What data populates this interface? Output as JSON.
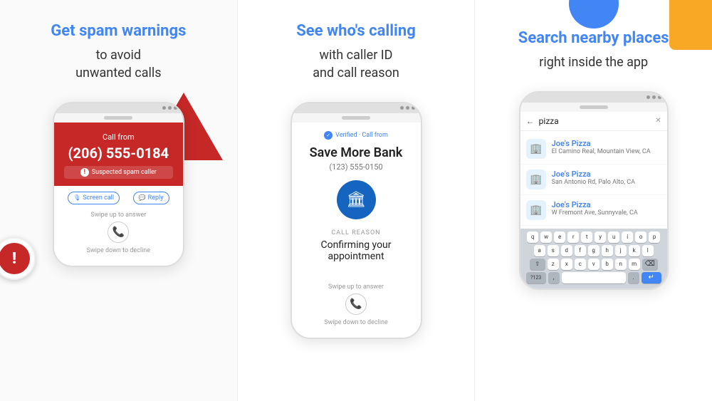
{
  "panels": [
    {
      "id": "spam",
      "title_highlight": "Get spam warnings",
      "subtitle": "to avoid\nunwanted calls",
      "phone": {
        "call_from_label": "Call from",
        "number": "(206) 555-0184",
        "warning": "Suspected spam caller",
        "screen_call": "Screen call",
        "reply": "Reply",
        "swipe_up": "Swipe up to answer",
        "swipe_down": "Swipe down to decline"
      }
    },
    {
      "id": "caller-id",
      "title_highlight": "See who's calling",
      "subtitle": "with caller ID\nand call reason",
      "phone": {
        "verified_text": "Verified · Call from",
        "caller_name": "Save More Bank",
        "caller_number": "(123) 555-0150",
        "call_reason_label": "CALL REASON",
        "call_reason": "Confirming your appointment",
        "swipe_up": "Swipe up to answer",
        "swipe_down": "Swipe down to decline"
      }
    },
    {
      "id": "search",
      "title_highlight": "Search nearby places",
      "subtitle": "right inside the app",
      "phone": {
        "search_query": "pizza",
        "places": [
          {
            "name": "Joe's Pizza",
            "address": "El Camino Real, Mountain View, CA"
          },
          {
            "name": "Joe's Pizza",
            "address": "San Antonio Rd, Palo Alto, CA"
          },
          {
            "name": "Joe's Pizza",
            "address": "W Fremont Ave, Sunnyvale, CA"
          }
        ],
        "keyboard_rows": [
          [
            "q",
            "w",
            "e",
            "r",
            "t",
            "y",
            "u",
            "i",
            "o",
            "p"
          ],
          [
            "a",
            "s",
            "d",
            "f",
            "g",
            "h",
            "j",
            "k",
            "l"
          ],
          [
            "z",
            "x",
            "c",
            "v",
            "b",
            "n",
            "m"
          ]
        ],
        "num_label": "?123",
        "comma": ",",
        "period": "."
      }
    }
  ],
  "colors": {
    "blue": "#4285F4",
    "red": "#c62828",
    "yellow": "#F9A825",
    "bank_blue": "#1565C0"
  }
}
